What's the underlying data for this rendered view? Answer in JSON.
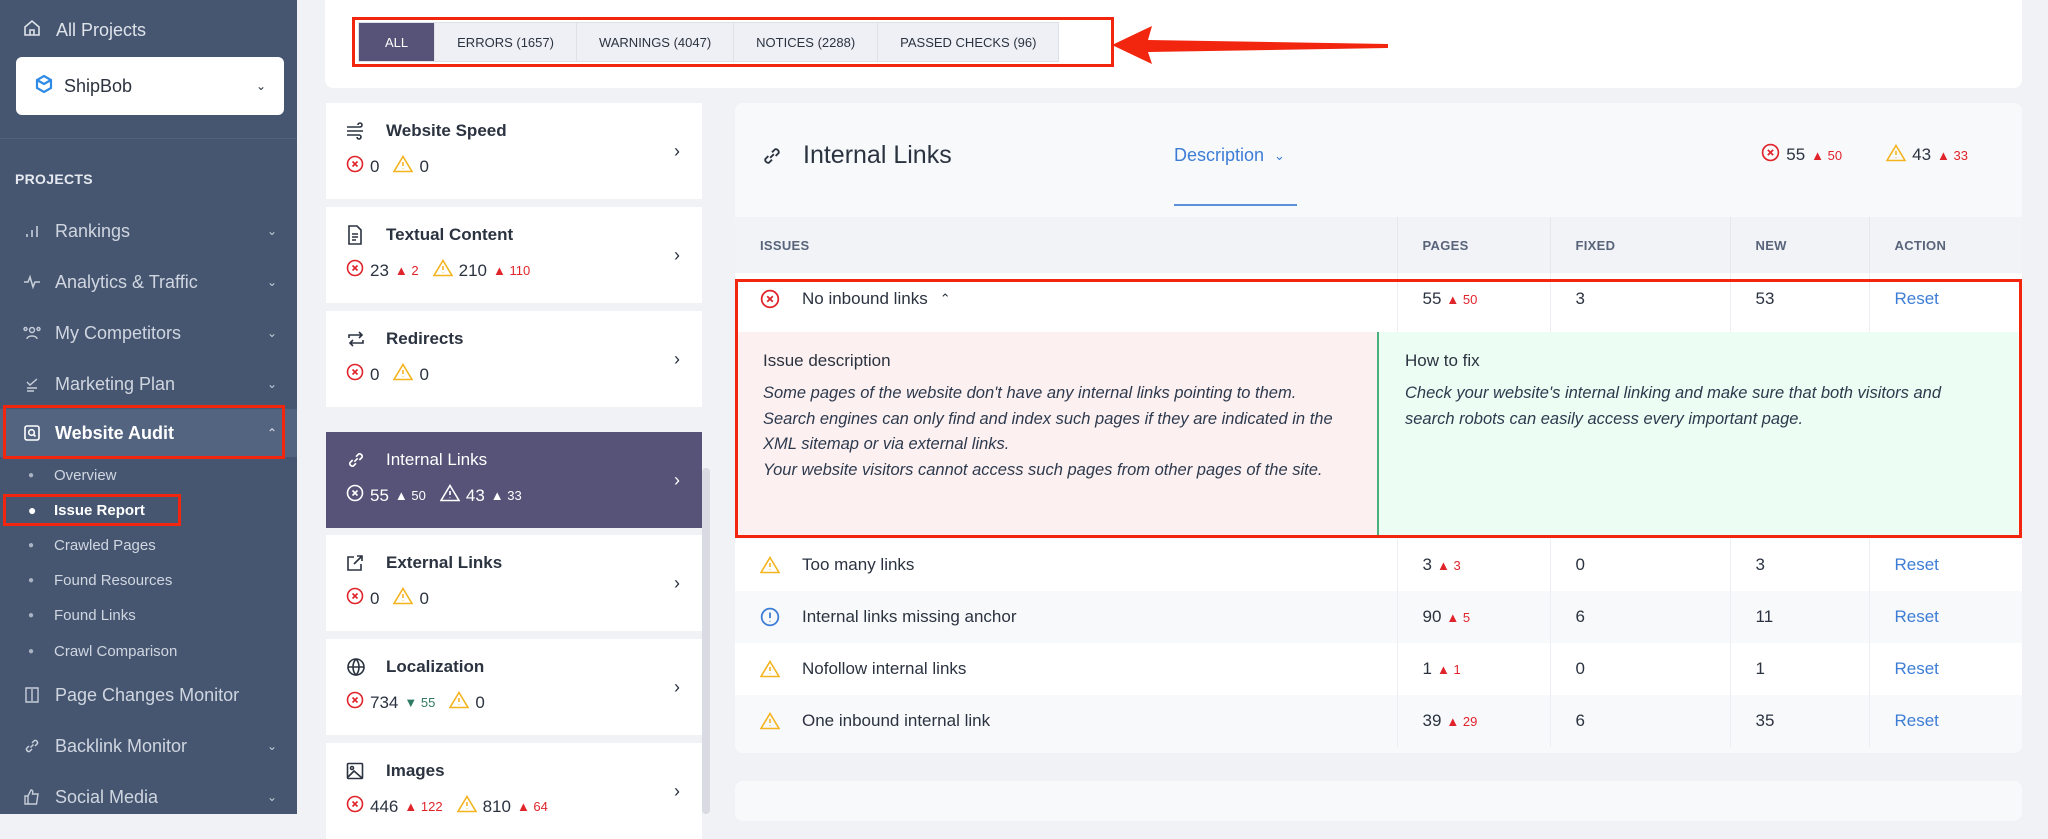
{
  "sidebar": {
    "all_projects": "All Projects",
    "project": "ShipBob",
    "section_label": "PROJECTS",
    "items": [
      {
        "label": "Rankings",
        "icon": "bar-chart-icon"
      },
      {
        "label": "Analytics & Traffic",
        "icon": "pulse-icon"
      },
      {
        "label": "My Competitors",
        "icon": "users-icon"
      },
      {
        "label": "Marketing Plan",
        "icon": "checklist-icon"
      },
      {
        "label": "Website Audit",
        "icon": "audit-search-icon"
      },
      {
        "label": "Page Changes Monitor",
        "icon": "compare-icon"
      },
      {
        "label": "Backlink Monitor",
        "icon": "link-icon"
      },
      {
        "label": "Social Media",
        "icon": "thumbs-up-icon"
      }
    ],
    "sub_items": [
      "Overview",
      "Issue Report",
      "Crawled Pages",
      "Found Resources",
      "Found Links",
      "Crawl Comparison"
    ],
    "active_sub": "Issue Report"
  },
  "filter_tabs": [
    {
      "label": "ALL",
      "active": true
    },
    {
      "label": "ERRORS (1657)"
    },
    {
      "label": "WARNINGS (4047)"
    },
    {
      "label": "NOTICES (2288)"
    },
    {
      "label": "PASSED CHECKS (96)"
    }
  ],
  "categories": [
    {
      "name": "Website Speed",
      "icon": "speed-icon",
      "errors": "0",
      "errors_delta": "",
      "warnings": "0",
      "warnings_delta": ""
    },
    {
      "name": "Textual Content",
      "icon": "document-icon",
      "errors": "23",
      "errors_delta": "2",
      "warnings": "210",
      "warnings_delta": "110"
    },
    {
      "name": "Redirects",
      "icon": "redirect-icon",
      "errors": "0",
      "errors_delta": "",
      "warnings": "0",
      "warnings_delta": ""
    },
    {
      "name": "Internal Links",
      "icon": "link-icon",
      "errors": "55",
      "errors_delta": "50",
      "warnings": "43",
      "warnings_delta": "33",
      "active": true
    },
    {
      "name": "External Links",
      "icon": "external-link-icon",
      "errors": "0",
      "errors_delta": "",
      "warnings": "0",
      "warnings_delta": ""
    },
    {
      "name": "Localization",
      "icon": "globe-icon",
      "errors": "734",
      "errors_delta": "55",
      "errors_delta_dir": "down",
      "warnings": "0",
      "warnings_delta": ""
    },
    {
      "name": "Images",
      "icon": "image-icon",
      "errors": "446",
      "errors_delta": "122",
      "warnings": "810",
      "warnings_delta": "64"
    }
  ],
  "main": {
    "title": "Internal Links",
    "description_tab": "Description",
    "errors": "55",
    "errors_delta": "50",
    "warnings": "43",
    "warnings_delta": "33",
    "columns": [
      "ISSUES",
      "PAGES",
      "FIXED",
      "NEW",
      "ACTION"
    ],
    "rows": [
      {
        "type": "error",
        "issue": "No inbound links",
        "pages": "55",
        "pages_delta": "50",
        "fixed": "3",
        "new": "53",
        "action": "Reset",
        "expanded": true
      },
      {
        "type": "warning",
        "issue": "Too many links",
        "pages": "3",
        "pages_delta": "3",
        "fixed": "0",
        "new": "3",
        "action": "Reset"
      },
      {
        "type": "notice",
        "issue": "Internal links missing anchor",
        "pages": "90",
        "pages_delta": "5",
        "fixed": "6",
        "new": "11",
        "action": "Reset"
      },
      {
        "type": "warning",
        "issue": "Nofollow internal links",
        "pages": "1",
        "pages_delta": "1",
        "fixed": "0",
        "new": "1",
        "action": "Reset"
      },
      {
        "type": "warning",
        "issue": "One inbound internal link",
        "pages": "39",
        "pages_delta": "29",
        "fixed": "6",
        "new": "35",
        "action": "Reset"
      }
    ],
    "issue_description_title": "Issue description",
    "issue_description": "Some pages of the website don't have any internal links pointing to them. Search engines can only find and index such pages if they are indicated in the XML sitemap or via external links.",
    "issue_description_2": "Your website visitors cannot access such pages from other pages of the site.",
    "how_to_fix_title": "How to fix",
    "how_to_fix": "Check your website's internal linking and make sure that both visitors and search robots can easily access every important page."
  },
  "colors": {
    "sidebar": "#465671",
    "active_tab": "#575277",
    "error": "#e0242b",
    "warning": "#f5b41f",
    "notice": "#3d7dd6",
    "link": "#3d7dd6",
    "annotation": "#f2250f"
  }
}
